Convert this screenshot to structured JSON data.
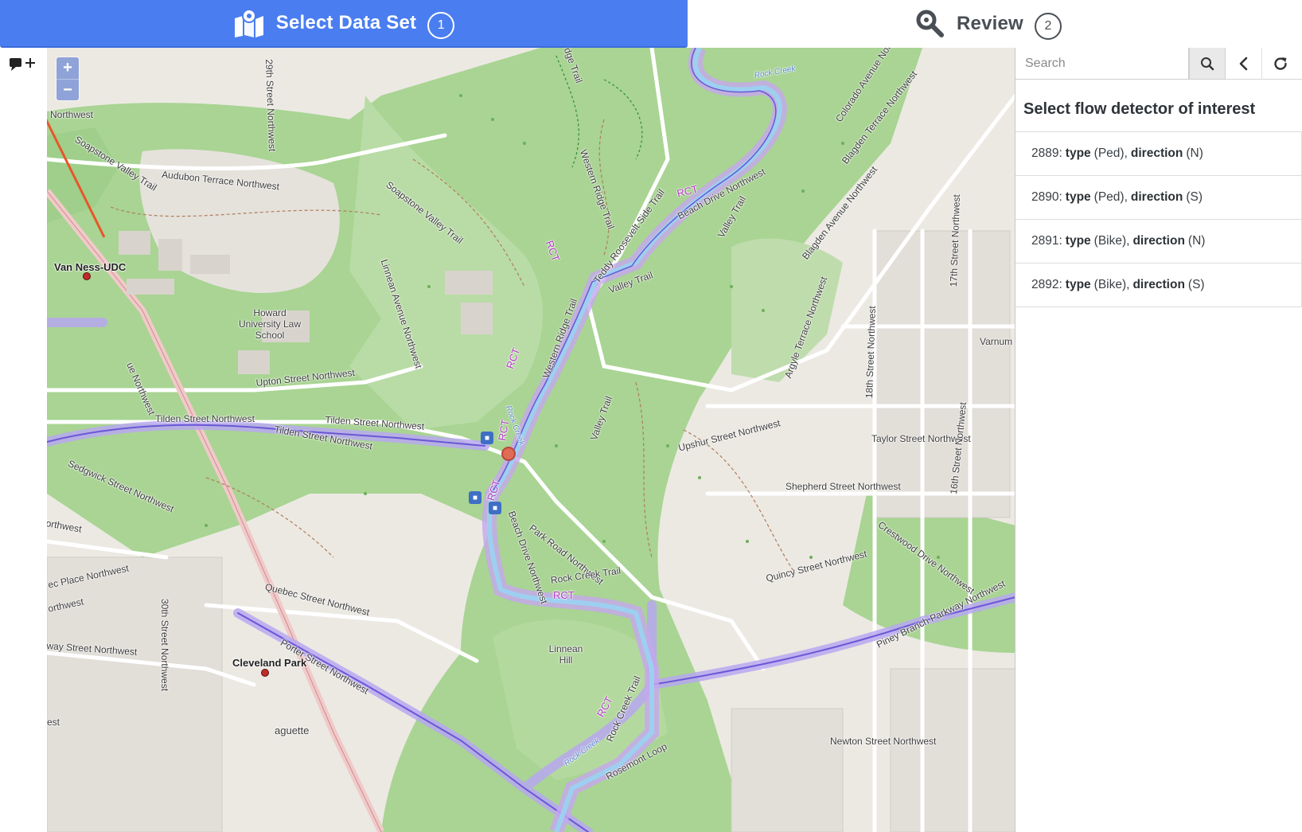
{
  "steps": [
    {
      "icon": "map-marker-icon",
      "title": "Select Data Set",
      "number": "1",
      "active": true
    },
    {
      "icon": "magnifier-icon",
      "title": "Review",
      "number": "2",
      "active": false
    }
  ],
  "tools": {
    "comment_icon": "comment-plus-icon"
  },
  "map": {
    "zoom_in": "+",
    "zoom_out": "−",
    "labels": {
      "van_ness": "Van Ness-UDC",
      "howard": "Howard University Law School",
      "northwest": "Northwest",
      "soapstone1": "Soapstone Valley Trail",
      "soapstone2": "Soapstone Valley Trail",
      "audubon": "Audubon Terrace Northwest",
      "linnean_ave": "Linnean Avenue Northwest",
      "upton": "Upton Street Northwest",
      "tilden1": "Tilden Street Northwest",
      "tilden2": "Tilden Street Northwest",
      "tilden3": "Tilden Street Northwest",
      "sedgwick": "Sedgwick Street Northwest",
      "orthwest1": "orthwest",
      "ec_place": "ec Place Northwest",
      "orthwest2": "orthwest",
      "quebec": "Quebec Street Northwest",
      "porter": "Porter Street Northwest",
      "cleveland": "Cleveland Park",
      "way_street": "way Street Northwest",
      "street_30": "30th Street Northwest",
      "street_29": "29th Street Northwest",
      "est": "est",
      "baguette": "aguette",
      "ct_ave": "ue Northwest",
      "western_ridge1": "Western Ridge Trail",
      "western_ridge2": "Western Ridge Trail",
      "ridge_trail": "dge Trail",
      "teddy": "Teddy Roosevelt Side Trail",
      "valley1": "Valley Trail",
      "valley2": "Valley Trail",
      "valley3": "Valley Trail",
      "beach_drive1": "Beach Drive Northwest",
      "beach_drive2": "Beach Drive Northwest",
      "park_road": "Park Road Northwest",
      "rock_creek_trail1": "Rock Creek Trail",
      "rock_creek_trail2": "Rock Creek Trail",
      "rosemont": "Rosemont Loop",
      "linnean_hill": "Linnean Hill",
      "colorado": "Colorado Avenue Northwest",
      "blagden_terrace": "Blagden Terrace Northwest",
      "blagden_ave": "Blagden Avenue Northwest",
      "street_17": "17th Street Northwest",
      "argyle": "Argyle Terrace Northwest",
      "street_18": "18th Street Northwest",
      "varnum": "Varnum",
      "upshur": "Upshur Street Northwest",
      "taylor": "Taylor Street Northwest",
      "shepherd": "Shepherd Street Northwest",
      "crestwood": "Crestwood Drive Northwest",
      "street_16": "16th Street Northwest",
      "quincy": "Quincy Street Northwest",
      "piney": "Piney Branch Parkway Northwest",
      "newton": "Newton Street Northwest",
      "rct1": "RCT",
      "rct2": "RCT",
      "rct3": "RCT",
      "rct4": "RCT",
      "rct5": "RCT",
      "rct6": "RCT",
      "rct7": "RCT",
      "rock_creek1": "Rock Creek",
      "rock_creek2": "Rock Creek",
      "rock_creek3": "Rock Creek"
    }
  },
  "panel": {
    "search": {
      "placeholder": "Search"
    },
    "buttons": [
      "search-icon",
      "chevron-left-icon",
      "refresh-icon"
    ],
    "title": "Select flow detector of interest",
    "detectors": [
      {
        "id": "2889:",
        "type_label": "type",
        "type": "(Ped),",
        "dir_label": "direction",
        "dir": "(N)"
      },
      {
        "id": "2890:",
        "type_label": "type",
        "type": "(Ped),",
        "dir_label": "direction",
        "dir": "(S)"
      },
      {
        "id": "2891:",
        "type_label": "type",
        "type": "(Bike),",
        "dir_label": "direction",
        "dir": "(N)"
      },
      {
        "id": "2892:",
        "type_label": "type",
        "type": "(Bike),",
        "dir_label": "direction",
        "dir": "(S)"
      }
    ]
  },
  "colors": {
    "accent": "#4a7df0",
    "trail": "#9a8fe0",
    "park": "#9fcf8b",
    "water": "#aed3ef",
    "arrow": "#e8562b"
  }
}
